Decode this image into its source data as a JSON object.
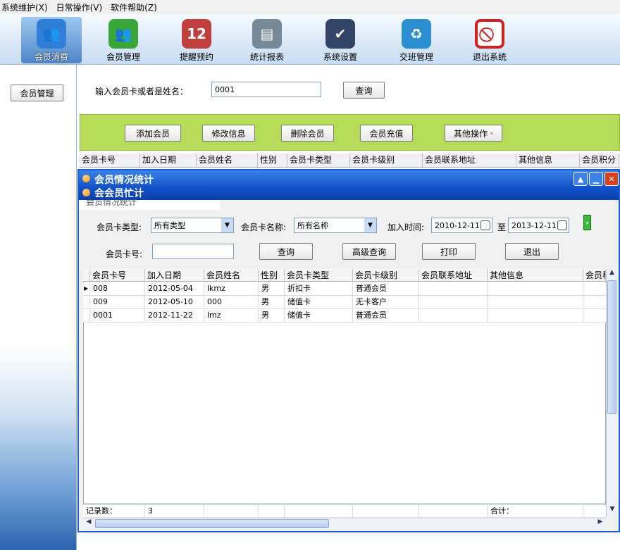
{
  "menu": [
    "系统维护(X)",
    "日常操作(V)",
    "软件帮助(Z)"
  ],
  "toolbar": [
    {
      "label": "会员消费",
      "icon": "members-consume-icon",
      "color": "#2f7fd8"
    },
    {
      "label": "会员管理",
      "icon": "members-manage-icon",
      "color": "#3aa63a"
    },
    {
      "label": "提醒预约",
      "icon": "calendar-icon",
      "color": "#c04040"
    },
    {
      "label": "统计报表",
      "icon": "report-icon",
      "color": "#555555"
    },
    {
      "label": "系统设置",
      "icon": "settings-icon",
      "color": "#334466"
    },
    {
      "label": "交班管理",
      "icon": "shift-icon",
      "color": "#2a8ed0"
    },
    {
      "label": "退出系统",
      "icon": "exit-icon",
      "color": "#d02020"
    }
  ],
  "sidebar": {
    "member_btn": "会员管理"
  },
  "search": {
    "label": "输入会员卡或者是姓名：",
    "value": "0001",
    "query": "查询"
  },
  "actions": {
    "add": "添加会员",
    "edit": "修改信息",
    "delete": "删除会员",
    "recharge": "会员充值",
    "other": "其他操作"
  },
  "bg_columns": [
    "会员卡号",
    "加入日期",
    "会员姓名",
    "性别",
    "会员卡类型",
    "会员卡级别",
    "会员联系地址",
    "其他信息",
    "会员积分"
  ],
  "dialog": {
    "title1": "会员情况统计",
    "title2": "会会员忙计",
    "title3": "会员情况统计",
    "card_type_label": "会员卡类型:",
    "card_type_value": "所有类型",
    "card_name_label": "会员卡名称:",
    "card_name_value": "所有名称",
    "join_label": "加入时间:",
    "date_from": "2010-12-11",
    "to": "至",
    "date_to": "2013-12-11",
    "card_no_label": "会员卡号:",
    "query": "查询",
    "advanced": "高级查询",
    "print": "打印",
    "exit": "退出",
    "columns": [
      "会员卡号",
      "加入日期",
      "会员姓名",
      "性别",
      "会员卡类型",
      "会员卡级别",
      "会员联系地址",
      "其他信息",
      "会员积"
    ],
    "rows": [
      [
        "008",
        "2012-05-04",
        "lkmz",
        "男",
        "折扣卡",
        "普通会员",
        "",
        ""
      ],
      [
        "009",
        "2012-05-10",
        "000",
        "男",
        "储值卡",
        "无卡客户",
        "",
        ""
      ],
      [
        "0001",
        "2012-11-22",
        "lmz",
        "男",
        "储值卡",
        "普通会员",
        "",
        ""
      ]
    ],
    "footer_label": "记录数：",
    "footer_count": "3",
    "total_label": "合计："
  }
}
